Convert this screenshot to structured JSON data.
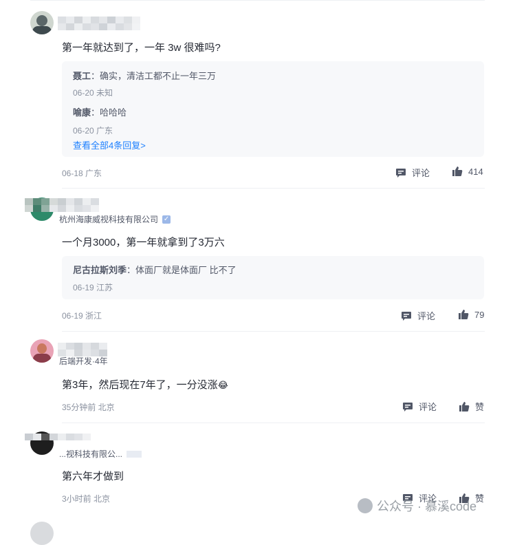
{
  "comments": [
    {
      "text": "第一年就达到了，一年 3w 很难吗?",
      "replies": [
        {
          "author": "聂工",
          "sep": "：",
          "text": "确实，清洁工都不止一年三万",
          "meta": "06-20 未知"
        },
        {
          "author": "喻康",
          "sep": "：",
          "text": "哈哈哈",
          "meta": "06-20 广东"
        }
      ],
      "more_replies": "查看全部4条回复>",
      "meta": "06-18 广东",
      "comment_label": "评论",
      "like_label": "414"
    },
    {
      "org": "杭州海康威视科技有限公司",
      "text": "一个月3000，第一年就拿到了3万六",
      "replies": [
        {
          "author": "尼古拉斯刘季",
          "sep": "：",
          "text": "体面厂就是体面厂 比不了",
          "meta": "06-19 江苏"
        }
      ],
      "meta": "06-19 浙江",
      "comment_label": "评论",
      "like_label": "79"
    },
    {
      "org": "后端开发·4年",
      "text": "第3年，然后现在7年了，一分没涨",
      "emoji": "😂",
      "meta": "35分钟前 北京",
      "comment_label": "评论",
      "like_label": "赞"
    },
    {
      "org": "...视科技有限公...",
      "text": "第六年才做到",
      "meta": "3小时前 北京",
      "comment_label": "评论",
      "like_label": "赞"
    }
  ],
  "watermark": {
    "text": "公众号 · 慕溪code"
  },
  "colors": {
    "text": "#252933",
    "secondary": "#515767",
    "meta": "#8a919f",
    "link": "#1e80ff",
    "reply_bg": "#f7f8fa"
  }
}
